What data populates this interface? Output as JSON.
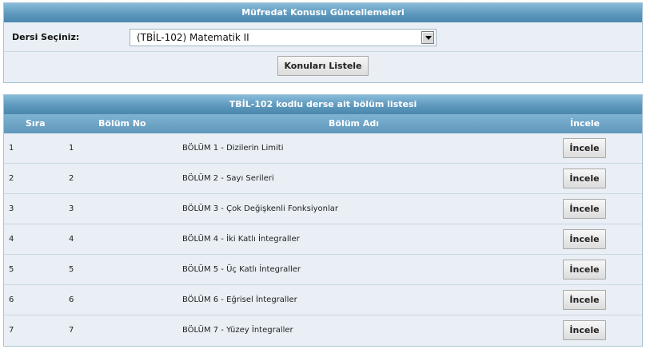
{
  "top_panel": {
    "title": "Müfredat Konusu Güncellemeleri",
    "course_label": "Dersi Seçiniz:",
    "course_selected": "(TBİL-102) Matematik II",
    "list_button": "Konuları Listele"
  },
  "list_panel": {
    "title": "TBİL-102 kodlu derse ait bölüm listesi",
    "columns": {
      "order": "Sıra",
      "section_no": "Bölüm No",
      "section_name": "Bölüm Adı",
      "inspect": "İncele"
    },
    "rows": [
      {
        "order": "1",
        "section_no": "1",
        "section_name": "BÖLÜM 1 - Dizilerin Limiti",
        "button": "İncele"
      },
      {
        "order": "2",
        "section_no": "2",
        "section_name": "BÖLÜM 2 - Sayı Serileri",
        "button": "İncele"
      },
      {
        "order": "3",
        "section_no": "3",
        "section_name": "BÖLÜM 3 - Çok Değişkenli Fonksiyonlar",
        "button": "İncele"
      },
      {
        "order": "4",
        "section_no": "4",
        "section_name": "BÖLÜM 4 - İki Katlı İntegraller",
        "button": "İncele"
      },
      {
        "order": "5",
        "section_no": "5",
        "section_name": "BÖLÜM 5 - Üç Katlı İntegraller",
        "button": "İncele"
      },
      {
        "order": "6",
        "section_no": "6",
        "section_name": "BÖLÜM 6 - Eğrisel İntegraller",
        "button": "İncele"
      },
      {
        "order": "7",
        "section_no": "7",
        "section_name": "BÖLÜM 7 - Yüzey İntegraller",
        "button": "İncele"
      }
    ]
  }
}
